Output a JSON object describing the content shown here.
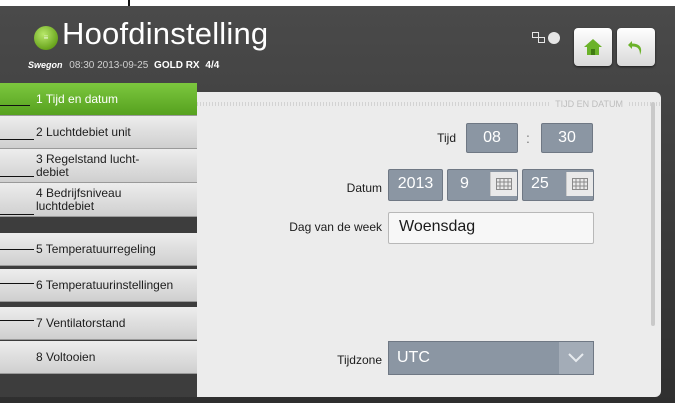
{
  "header": {
    "title": "Hoofdinstelling",
    "brand": "Swegon",
    "datetime": "08:30 2013-09-25",
    "unit_name": "GOLD RX",
    "step": "4/4",
    "logo_icon": "equalizer-icon",
    "home_icon": "home-icon",
    "back_icon": "back-arrow-icon",
    "accent_color": "#5fae24"
  },
  "sidebar": {
    "items": [
      {
        "label": "1 Tijd en datum",
        "active": true
      },
      {
        "label": "2 Luchtdebiet unit"
      },
      {
        "label": "3 Regelstand lucht-\ndebiet"
      },
      {
        "label": "4 Bedrijfsniveau\nluchtdebiet"
      },
      {
        "label": "5 Temperatuurregeling"
      },
      {
        "label": "6 Temperatuurinstellingen"
      },
      {
        "label": "7 Ventilatorstand"
      },
      {
        "label": "8 Voltooien"
      }
    ]
  },
  "panel": {
    "title": "TIJD EN DATUM",
    "time_label": "Tijd",
    "hour": "08",
    "separator": ":",
    "minute": "30",
    "date_label": "Datum",
    "year": "2013",
    "month": "9",
    "day": "25",
    "weekday_label": "Dag van de week",
    "weekday": "Woensdag",
    "timezone_label": "Tijdzone",
    "timezone": "UTC"
  }
}
